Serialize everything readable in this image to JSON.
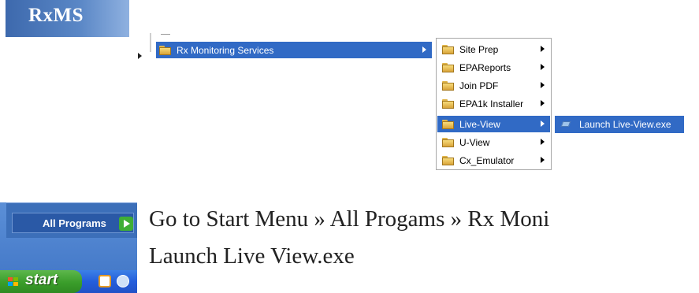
{
  "logo": {
    "text": "RxMS"
  },
  "start_menu": {
    "all_programs_label": "All Programs",
    "start_label": "start"
  },
  "menus": {
    "level1": {
      "label": "Rx Monitoring Services",
      "icon": "folder-icon"
    },
    "level2": [
      {
        "label": "Site Prep",
        "icon": "folder-icon",
        "selected": false
      },
      {
        "label": "EPAReports",
        "icon": "folder-icon",
        "selected": false
      },
      {
        "label": "Join PDF",
        "icon": "folder-icon",
        "selected": false
      },
      {
        "label": "EPA1k Installer",
        "icon": "folder-icon",
        "selected": false
      },
      {
        "label": "Live-View",
        "icon": "folder-icon",
        "selected": true
      },
      {
        "label": "U-View",
        "icon": "folder-icon",
        "selected": false
      },
      {
        "label": "Cx_Emulator",
        "icon": "folder-icon",
        "selected": false
      }
    ],
    "level3": {
      "label": "Launch Live-View.exe",
      "icon": "exe-icon"
    }
  },
  "instructions": {
    "line1": "Go to Start Menu » All Progams » Rx Moni",
    "line2": "Launch Live View.exe"
  },
  "colors": {
    "menu_highlight": "#316ac5",
    "logo_blue": "#3d69ad",
    "start_green": "#3a9d2a"
  }
}
